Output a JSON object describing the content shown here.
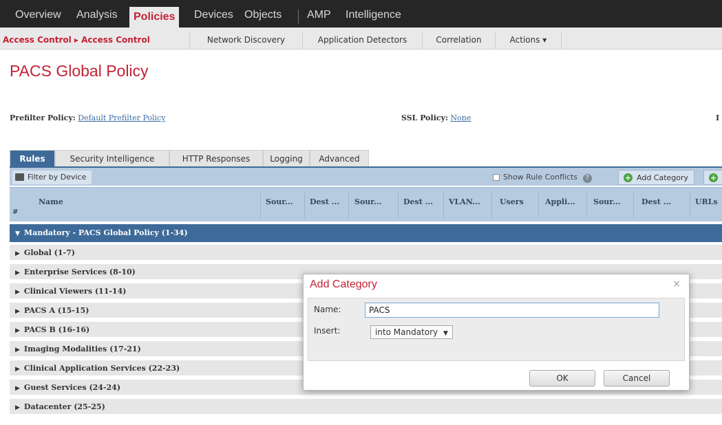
{
  "topnav": {
    "items": [
      "Overview",
      "Analysis",
      "Policies",
      "Devices",
      "Objects",
      "AMP",
      "Intelligence"
    ],
    "active": "Policies"
  },
  "subnav": {
    "breadcrumb": "Access Control ▸ Access Control",
    "items": [
      "Network Discovery",
      "Application Detectors",
      "Correlation",
      "Actions ▾"
    ]
  },
  "page": {
    "title": "PACS Global Policy",
    "prefilter_label": "Prefilter Policy:",
    "prefilter_value": "Default Prefilter Policy",
    "ssl_label": "SSL Policy:",
    "ssl_value": "None",
    "truncated_label": "I"
  },
  "tabs": [
    "Rules",
    "Security Intelligence",
    "HTTP Responses",
    "Logging",
    "Advanced"
  ],
  "toolbar": {
    "filter_label": "Filter by Device",
    "show_conflicts_label": "Show Rule Conflicts",
    "add_category_label": "Add Category"
  },
  "table": {
    "hash": "#",
    "columns": [
      "Name",
      "Sour...",
      "Dest ...",
      "Sour...",
      "Dest ...",
      "VLAN...",
      "Users",
      "Appli...",
      "Sour...",
      "Dest ...",
      "URLs"
    ]
  },
  "mandatory": "Mandatory - PACS Global Policy (1-34)",
  "categories": [
    "Global (1-7)",
    "Enterprise Services (8-10)",
    "Clinical Viewers (11-14)",
    "PACS A (15-15)",
    "PACS B (16-16)",
    "Imaging Modalities (17-21)",
    "Clinical Application Services (22-23)",
    "Guest Services (24-24)",
    "Datacenter (25-25)"
  ],
  "dialog": {
    "title": "Add Category",
    "close": "×",
    "name_label": "Name:",
    "name_value": "PACS",
    "insert_label": "Insert:",
    "insert_value": "into Mandatory",
    "ok_label": "OK",
    "cancel_label": "Cancel"
  },
  "colors": {
    "brand_red": "#c42235",
    "header_blue": "#3d6a98",
    "table_header": "#b7cbe0"
  }
}
